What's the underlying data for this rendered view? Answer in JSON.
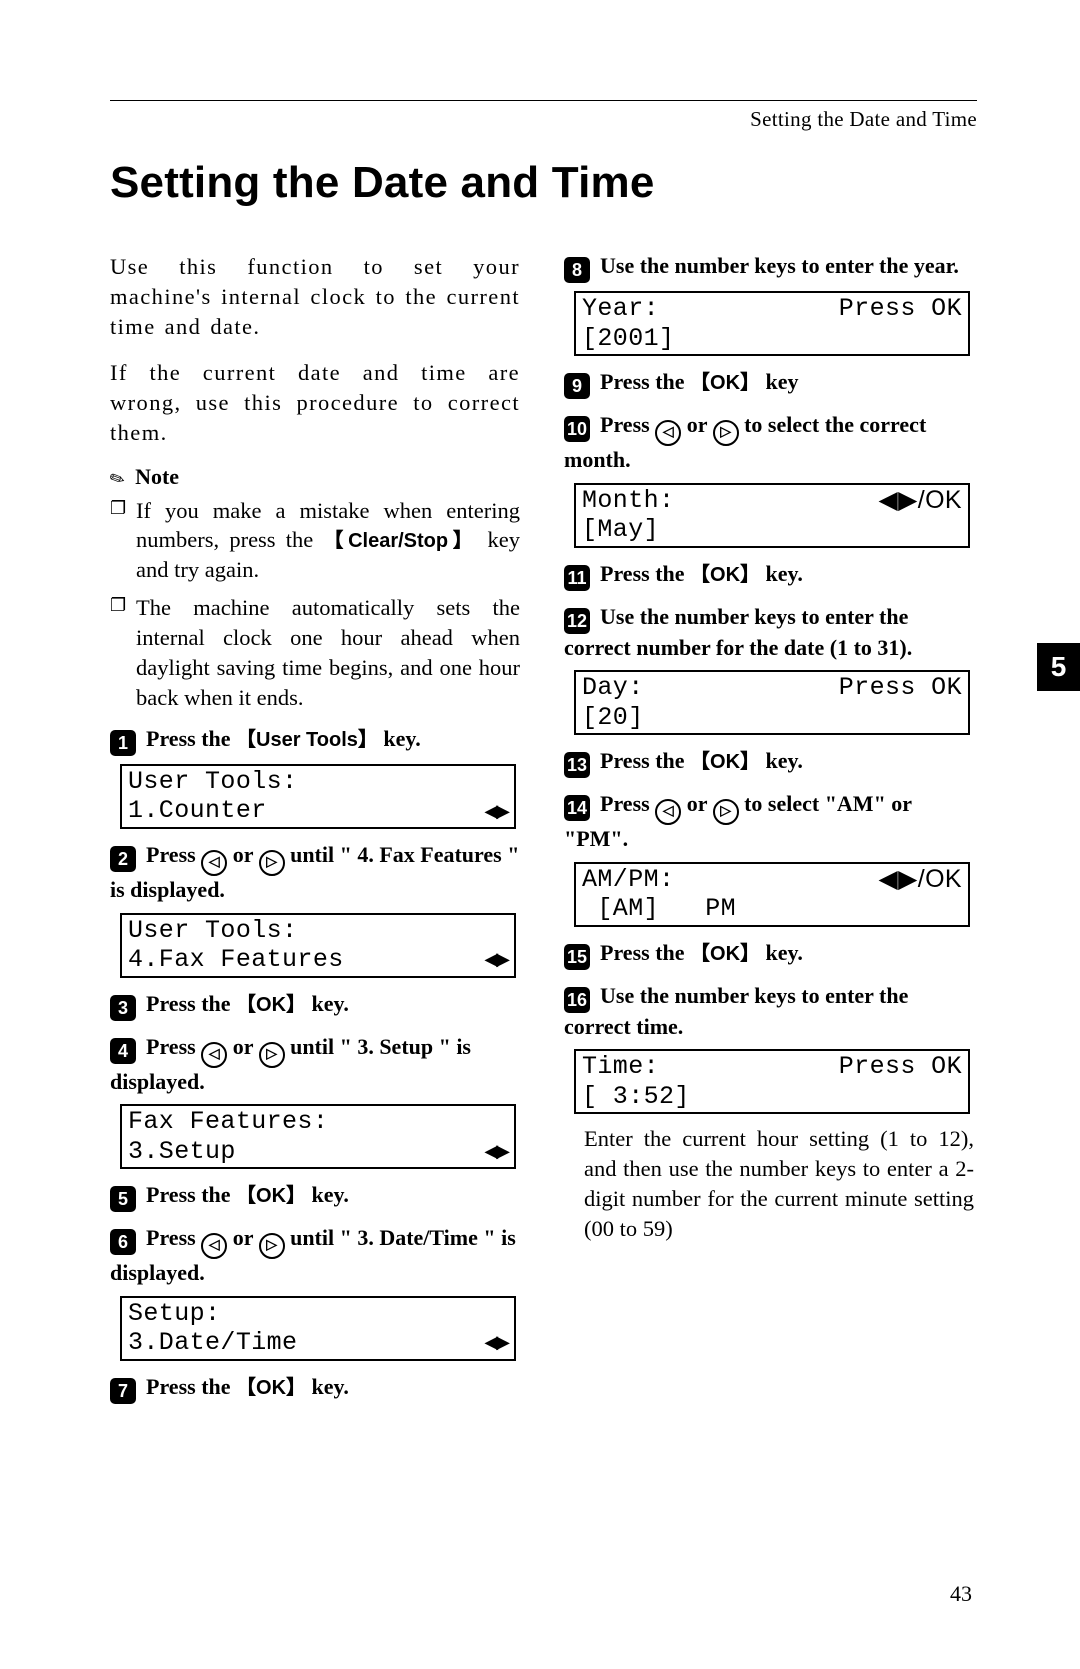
{
  "header": {
    "running_title": "Setting the Date and Time"
  },
  "title": "Setting the Date and Time",
  "section_tab": "5",
  "page_number": "43",
  "intro": {
    "p1": "Use this function to set your machine's internal clock to the current time and date.",
    "p2": "If the current date and time are wrong, use this procedure to correct them."
  },
  "note": {
    "label": "Note",
    "items": [
      {
        "pre": "If you make a mistake when entering numbers, press the ",
        "key": "Clear/Stop",
        "post": " key and try again."
      },
      {
        "full": "The machine automatically sets the internal clock one hour ahead when daylight saving time begins, and one hour back when it ends."
      }
    ]
  },
  "keys": {
    "user_tools": "User Tools",
    "ok": "OK"
  },
  "arrows": {
    "lr_glyph": "◀▶",
    "lrok": "◀▶/OK",
    "left": "◁",
    "right": "▷"
  },
  "steps": {
    "s1": {
      "n": "1",
      "pre": "Press the ",
      "key": "user_tools",
      "post": " key."
    },
    "s2": {
      "n": "2",
      "text_a": "Press ",
      "text_b": " or ",
      "text_c": " until \" 4. Fax Features \" is displayed."
    },
    "s3": {
      "n": "3",
      "pre": "Press the ",
      "key": "ok",
      "post": " key."
    },
    "s4": {
      "n": "4",
      "text_a": "Press ",
      "text_b": " or ",
      "text_c": " until \" 3. Setup \" is displayed."
    },
    "s5": {
      "n": "5",
      "pre": "Press the ",
      "key": "ok",
      "post": " key."
    },
    "s6": {
      "n": "6",
      "text_a": "Press ",
      "text_b": " or ",
      "text_c": " until \" 3. Date/Time \" is displayed."
    },
    "s7": {
      "n": "7",
      "pre": "Press the ",
      "key": "ok",
      "post": " key."
    },
    "s8": {
      "n": "8",
      "full": "Use the number keys to enter the year."
    },
    "s9": {
      "n": "9",
      "pre": "Press the ",
      "key": "ok",
      "post": " key"
    },
    "s10": {
      "n": "10",
      "text_a": "Press ",
      "text_b": " or ",
      "text_c": " to select the correct month."
    },
    "s11": {
      "n": "11",
      "pre": "Press the ",
      "key": "ok",
      "post": " key."
    },
    "s12": {
      "n": "12",
      "full": "Use the number keys to enter the correct number for the date (1 to 31)."
    },
    "s13": {
      "n": "13",
      "pre": "Press the ",
      "key": "ok",
      "post": " key."
    },
    "s14": {
      "n": "14",
      "text_a": "Press ",
      "text_b": " or ",
      "text_c": " to select \"AM\" or \"PM\"."
    },
    "s15": {
      "n": "15",
      "pre": "Press the ",
      "key": "ok",
      "post": " key."
    },
    "s16": {
      "n": "16",
      "full": "Use the number keys to enter the correct time."
    }
  },
  "lcd": {
    "d1": {
      "l1": "User Tools:",
      "l2": "1.Counter"
    },
    "d2": {
      "l1": "User Tools:",
      "l2": "4.Fax Features"
    },
    "d3": {
      "l1": "Fax Features:",
      "l2": "3.Setup"
    },
    "d4": {
      "l1": "Setup:",
      "l2": "3.Date/Time"
    },
    "d5": {
      "l1a": "Year:",
      "l1b": "Press OK",
      "l2": "[2001]"
    },
    "d6": {
      "l1a": "Month:",
      "l2": "[May]"
    },
    "d7": {
      "l1a": "Day:",
      "l1b": "Press OK",
      "l2": "[20]"
    },
    "d8": {
      "l1a": "AM/PM:",
      "l2": " [AM]   PM"
    },
    "d9": {
      "l1a": "Time:",
      "l1b": "Press OK",
      "l2": "[ 3:52]"
    }
  },
  "trailer": "Enter the current hour setting (1 to 12), and then use the number keys to enter a 2-digit number for the current minute setting (00 to 59)"
}
